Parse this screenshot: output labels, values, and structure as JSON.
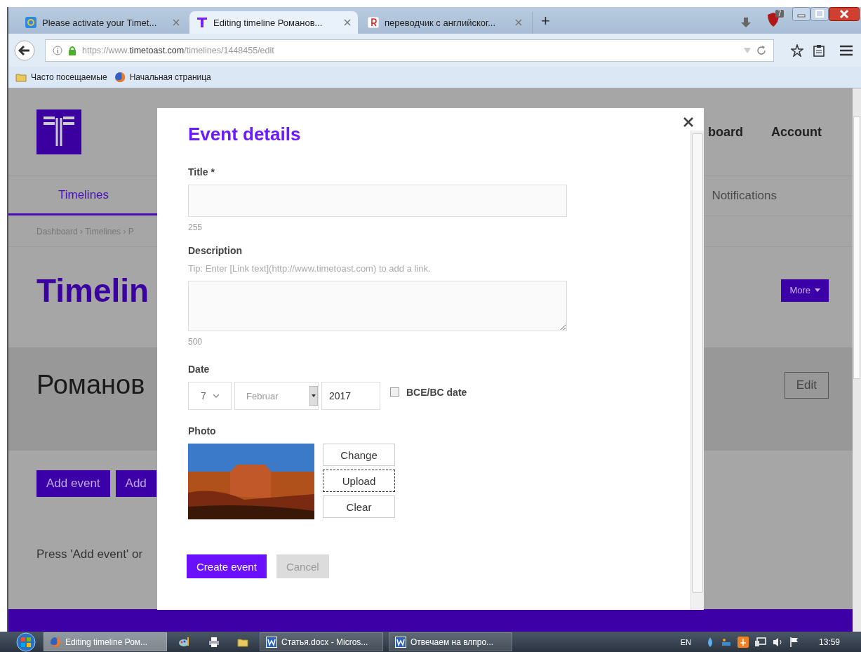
{
  "browser": {
    "tabs": [
      {
        "label": "Please activate your Timet...",
        "selected": false,
        "kind": "clock"
      },
      {
        "label": "Editing timeline Романов...",
        "selected": true,
        "kind": "timetoast"
      },
      {
        "label": "переводчик с английског...",
        "selected": false,
        "kind": "yandex"
      }
    ],
    "new_tab": "+",
    "extension_badge": "7",
    "url": "https://www.**timetoast.com**/timelines/1448455/edit",
    "bookmarks": [
      {
        "label": "Часто посещаемые",
        "kind": "folder"
      },
      {
        "label": "Начальная страница",
        "kind": "firefox"
      }
    ]
  },
  "page": {
    "nav": [
      "board",
      "Account"
    ],
    "subnav": [
      {
        "label": "Timelines",
        "selected": true
      },
      {
        "label": "Notifications",
        "selected": false
      }
    ],
    "breadcrumb": "Dashboard › Timelines › P",
    "heading": "Timelin",
    "more_button": "More",
    "timeline_name": "Романов",
    "edit_button": "Edit",
    "actions": [
      "Add event",
      "Add"
    ],
    "hint": "Press 'Add event' or"
  },
  "modal": {
    "title": "Event details",
    "title_label": "Title *",
    "title_counter": "255",
    "description_label": "Description",
    "description_tip": "Tip: Enter [Link text](http://www.timetoast.com) to add a link.",
    "description_counter": "500",
    "date_label": "Date",
    "day": "7",
    "month": "Februar",
    "year": "2017",
    "bce_label": "BCE/BC date",
    "bce_checked": false,
    "photo_label": "Photo",
    "photo_buttons": [
      {
        "label": "Change",
        "focused": false
      },
      {
        "label": "Upload",
        "focused": true
      },
      {
        "label": "Clear",
        "focused": false
      }
    ],
    "create_button": "Create event",
    "cancel_button": "Cancel",
    "cancel_disabled": true
  },
  "taskbar": {
    "items": [
      {
        "label": "Editing timeline Ром...",
        "kind": "firefox",
        "selected": true
      },
      {
        "kind": "paint",
        "selected": false
      },
      {
        "kind": "printer",
        "selected": false
      },
      {
        "kind": "folder",
        "selected": false
      },
      {
        "label": "Статья.docx - Micros...",
        "kind": "word",
        "selected": false
      },
      {
        "label": "Отвечаем на влпро...",
        "kind": "word",
        "selected": false
      }
    ],
    "language": "EN",
    "time": "13:59"
  }
}
